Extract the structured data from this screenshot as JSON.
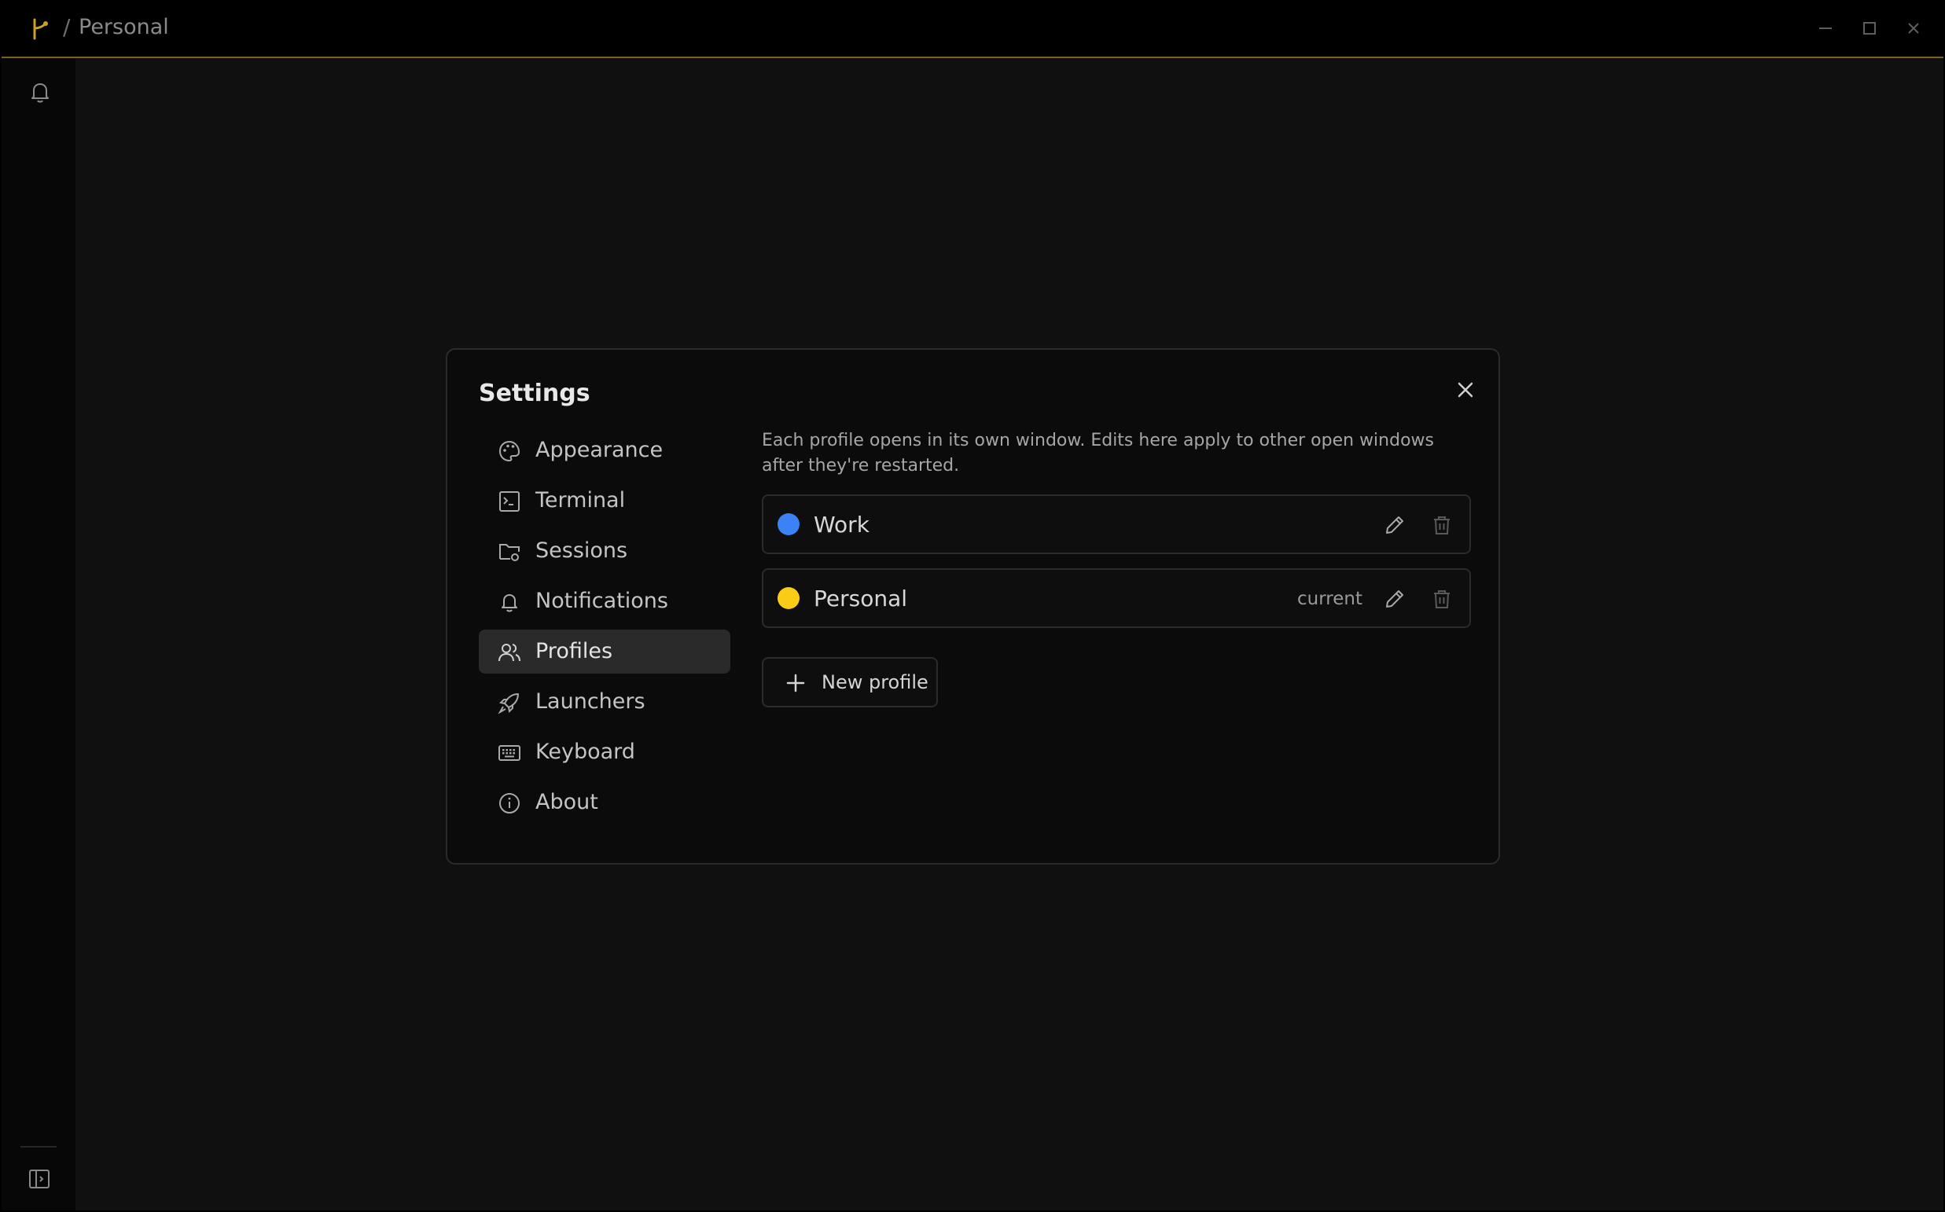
{
  "titlebar": {
    "separator": "/",
    "title": "Personal"
  },
  "colors": {
    "accent": "#7a6418",
    "work_profile": "#3b82f6",
    "personal_profile": "#facc15"
  },
  "settings": {
    "title": "Settings",
    "nav": [
      {
        "label": "Appearance",
        "icon": "palette-icon"
      },
      {
        "label": "Terminal",
        "icon": "terminal-icon"
      },
      {
        "label": "Sessions",
        "icon": "folder-gear-icon"
      },
      {
        "label": "Notifications",
        "icon": "bell-icon"
      },
      {
        "label": "Profiles",
        "icon": "users-icon",
        "active": true
      },
      {
        "label": "Launchers",
        "icon": "rocket-icon"
      },
      {
        "label": "Keyboard",
        "icon": "keyboard-icon"
      },
      {
        "label": "About",
        "icon": "info-icon"
      }
    ],
    "profiles": {
      "description": "Each profile opens in its own window. Edits here apply to other open windows after they're restarted.",
      "items": [
        {
          "name": "Work",
          "color": "#3b82f6",
          "current_label": ""
        },
        {
          "name": "Personal",
          "color": "#facc15",
          "current_label": "current"
        }
      ],
      "new_profile_label": "New profile"
    }
  }
}
